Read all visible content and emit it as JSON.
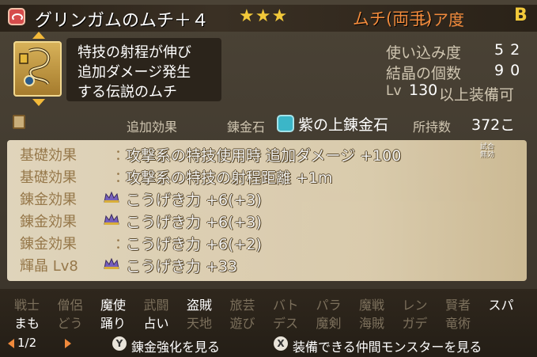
{
  "item": {
    "name": "グリンガムのムチ＋４",
    "stars": "★★★",
    "type": "ムチ(両手)",
    "rare_label": "レア度",
    "rare_grade": "B",
    "description": [
      "特技の射程が伸び",
      "追加ダメージ発生",
      "する伝説のムチ"
    ]
  },
  "stats": {
    "usage_label": "使い込み度",
    "usage_value": "52",
    "crystal_label": "結晶の個数",
    "crystal_value": "90",
    "lv_prefix": "Lv",
    "lv_value": "130",
    "lv_suffix": "以上装備可"
  },
  "alchemy": {
    "extra_effect_label": "追加効果",
    "stone_label": "錬金石",
    "stone_name": "紫の上錬金石",
    "owned_label": "所持数",
    "owned_value": "372こ"
  },
  "effects": [
    {
      "label": "基礎効果",
      "colon": "：",
      "text": "攻撃系の特技使用時 追加ダメージ +100",
      "note": "試合無効",
      "crown": false
    },
    {
      "label": "基礎効果",
      "colon": "：",
      "text": "攻撃系の特技の射程距離 +1m",
      "crown": false
    },
    {
      "label": "錬金効果",
      "colon": "：",
      "text": "こうげき力 +6(+3)",
      "crown": true
    },
    {
      "label": "錬金効果",
      "colon": "：",
      "text": "こうげき力 +6(+3)",
      "crown": true
    },
    {
      "label": "錬金効果",
      "colon": "：",
      "text": "こうげき力 +6(+2)",
      "crown": false
    },
    {
      "label": "輝晶 Lv8",
      "colon": "：",
      "text": "こうげき力 +33",
      "crown": true
    }
  ],
  "jobs_row1": [
    {
      "name": "戦士",
      "on": false
    },
    {
      "name": "僧侶",
      "on": false
    },
    {
      "name": "魔使",
      "on": true
    },
    {
      "name": "武闘",
      "on": false
    },
    {
      "name": "盗賊",
      "on": true
    },
    {
      "name": "旅芸",
      "on": false
    },
    {
      "name": "バト",
      "on": false
    },
    {
      "name": "パラ",
      "on": false
    },
    {
      "name": "魔戦",
      "on": false
    },
    {
      "name": "レン",
      "on": false
    },
    {
      "name": "賢者",
      "on": false
    },
    {
      "name": "スパ",
      "on": true
    }
  ],
  "jobs_row2": [
    {
      "name": "まも",
      "on": true
    },
    {
      "name": "どう",
      "on": false
    },
    {
      "name": "踊り",
      "on": true
    },
    {
      "name": "占い",
      "on": true
    },
    {
      "name": "天地",
      "on": false
    },
    {
      "name": "遊び",
      "on": false
    },
    {
      "name": "デス",
      "on": false
    },
    {
      "name": "魔剣",
      "on": false
    },
    {
      "name": "海賊",
      "on": false
    },
    {
      "name": "ガデ",
      "on": false
    },
    {
      "name": "竜術",
      "on": false
    }
  ],
  "footer": {
    "page": "1/2",
    "y_button": "Y",
    "y_label": "錬金強化を見る",
    "x_button": "X",
    "x_label": "装備できる仲間モンスターを見る"
  },
  "colors": {
    "accent_orange": "#f08a3c",
    "star_gold": "#f2c93a",
    "job_on": "#ffffff",
    "job_off": "#7c705c"
  }
}
